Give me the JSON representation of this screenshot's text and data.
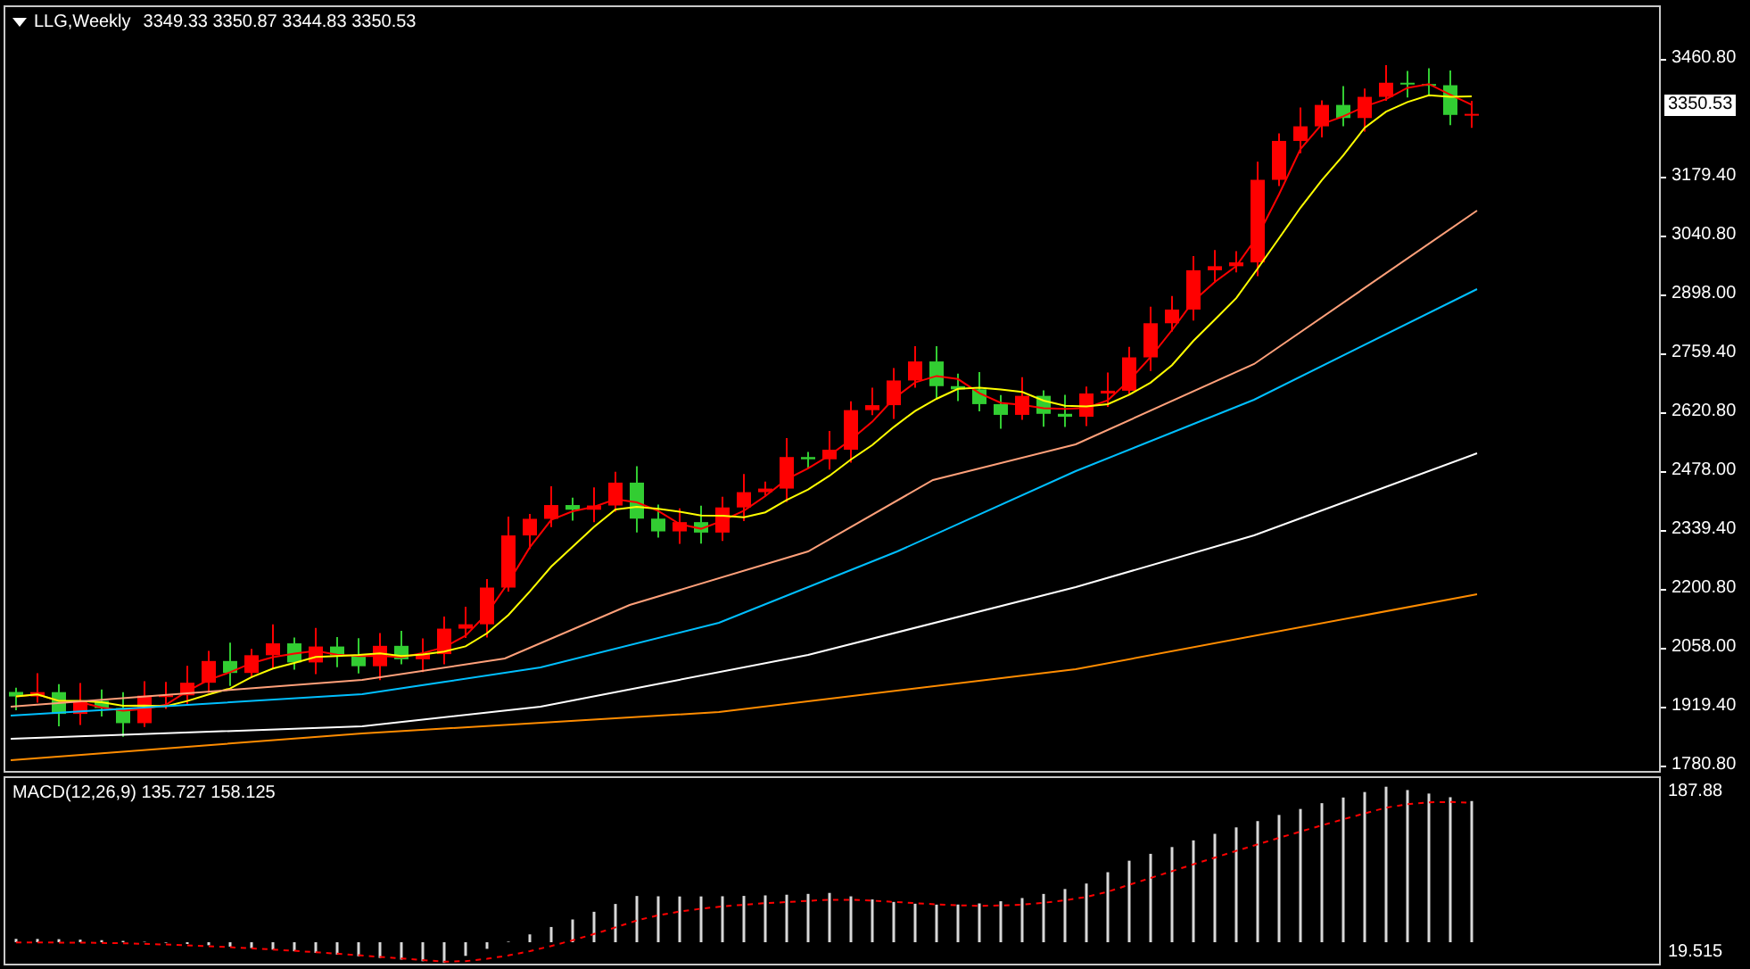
{
  "chart": {
    "symbol": "LLG,Weekly",
    "ohlc": "3349.33 3350.87 3344.83 3350.53",
    "price_ticks": [
      "3460.80",
      "3179.40",
      "3040.80",
      "2898.00",
      "2759.40",
      "2620.80",
      "2478.00",
      "2339.40",
      "2200.80",
      "2058.00",
      "1919.40",
      "1780.80"
    ],
    "current_price": "3350.53"
  },
  "macd": {
    "label": "MACD(12,26,9) 135.727 158.125",
    "ticks": [
      "187.88",
      "19.515"
    ]
  }
}
